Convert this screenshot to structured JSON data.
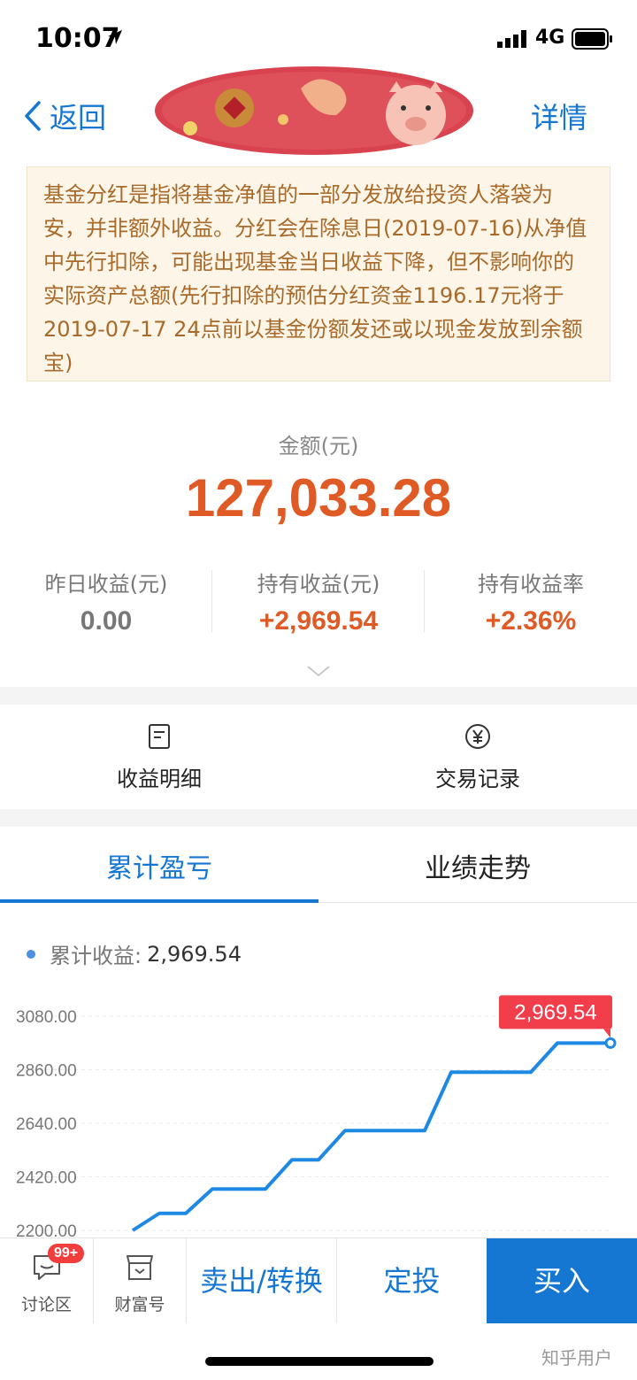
{
  "status_bar": {
    "time": "10:07",
    "network": "4G"
  },
  "nav": {
    "back_label": "返回",
    "detail_label": "详情"
  },
  "notice": {
    "text": "基金分红是指将基金净值的一部分发放给投资人落袋为安，并非额外收益。分红会在除息日(2019-07-16)从净值中先行扣除，可能出现基金当日收益下降，但不影响你的实际资产总额(先行扣除的预估分红资金1196.17元将于2019-07-17 24点前以基金份额发还或以现金发放到余额宝)"
  },
  "amount": {
    "label": "金额(元)",
    "value": "127,033.28"
  },
  "stats": [
    {
      "label": "昨日收益(元)",
      "value": "0.00"
    },
    {
      "label": "持有收益(元)",
      "value": "+2,969.54"
    },
    {
      "label": "持有收益率",
      "value": "+2.36%"
    }
  ],
  "actions": [
    {
      "label": "收益明细",
      "icon": "document-icon"
    },
    {
      "label": "交易记录",
      "icon": "yuan-circle-icon"
    }
  ],
  "tabs": [
    {
      "label": "累计盈亏",
      "active": true
    },
    {
      "label": "业绩走势",
      "active": false
    }
  ],
  "legend": {
    "label": "累计收益:",
    "value": "2,969.54"
  },
  "chart_data": {
    "type": "line",
    "y_ticks": [
      "3080.00",
      "2860.00",
      "2640.00",
      "2420.00",
      "2200.00"
    ],
    "ylim": [
      2200,
      3080
    ],
    "grid": true,
    "tooltip": "2,969.54",
    "series": [
      {
        "color": "#1e88e5",
        "values": [
          2200,
          2270,
          2270,
          2370,
          2370,
          2370,
          2490,
          2490,
          2610,
          2610,
          2610,
          2610,
          2850,
          2850,
          2850,
          2850,
          2969.54,
          2969.54,
          2969.54
        ]
      }
    ]
  },
  "bottom_bar": {
    "discuss": {
      "label": "讨论区",
      "badge": "99+"
    },
    "wealth": {
      "label": "财富号"
    },
    "sell": "卖出/转换",
    "fixed": "定投",
    "buy": "买入"
  },
  "watermark": "知乎用户",
  "colors": {
    "accent": "#1677d2",
    "up": "#e05a25",
    "notice_bg": "#fdf6e8",
    "badge": "#f23d3d"
  }
}
